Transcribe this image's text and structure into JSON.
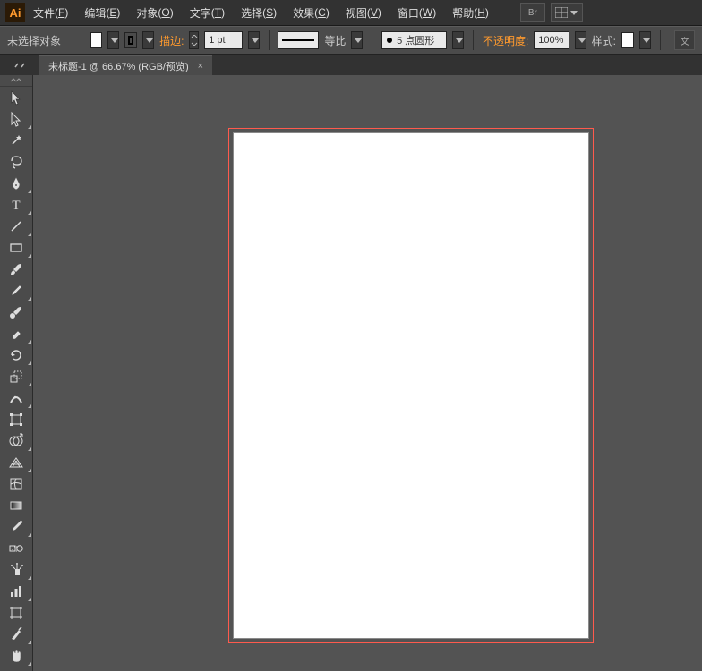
{
  "app_icon_text": "Ai",
  "menu": {
    "file": {
      "label": "文件",
      "mn": "F"
    },
    "edit": {
      "label": "编辑",
      "mn": "E"
    },
    "object": {
      "label": "对象",
      "mn": "O"
    },
    "type": {
      "label": "文字",
      "mn": "T"
    },
    "select": {
      "label": "选择",
      "mn": "S"
    },
    "effect": {
      "label": "效果",
      "mn": "C"
    },
    "view": {
      "label": "视图",
      "mn": "V"
    },
    "window": {
      "label": "窗口",
      "mn": "W"
    },
    "help": {
      "label": "帮助",
      "mn": "H"
    }
  },
  "bridge_btn": "Br",
  "options": {
    "selection_status": "未选择对象",
    "fill_color": "#ffffff",
    "stroke_color_sample": "#000000",
    "stroke_label": "描边:",
    "stroke_weight": "1 pt",
    "scale_label": "等比",
    "brush_label": "5 点圆形",
    "opacity_label": "不透明度:",
    "opacity_value": "100%",
    "style_label": "样式:",
    "style_swatch": "#ffffff",
    "more_label": "文"
  },
  "tab": {
    "title": "未标题-1 @ 66.67% (RGB/预览)",
    "close": "×"
  },
  "colors": {
    "artboard_outline": "#ff5a4d",
    "canvas_bg": "#535353"
  }
}
